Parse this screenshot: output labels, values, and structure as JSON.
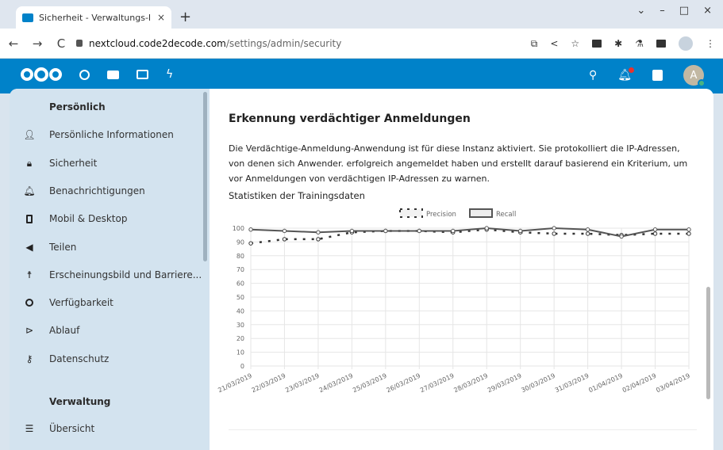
{
  "browser": {
    "tab_title": "Sicherheit - Verwaltungs-Ein",
    "tab_close": "×",
    "new_tab": "+",
    "url_host": "nextcloud.code2decode.com",
    "url_path": "/settings/admin/security",
    "win_min": "–",
    "win_max": "□",
    "win_close": "×",
    "chevron": "⌄",
    "back": "←",
    "forward": "→",
    "reload": "C"
  },
  "sidebar": {
    "personal_caption": "Persönlich",
    "personal_items": [
      {
        "label": "Persönliche Informationen",
        "icon": "person-icon"
      },
      {
        "label": "Sicherheit",
        "icon": "lock-icon"
      },
      {
        "label": "Benachrichtigungen",
        "icon": "bell-icon"
      },
      {
        "label": "Mobil & Desktop",
        "icon": "phone-icon"
      },
      {
        "label": "Teilen",
        "icon": "share-icon"
      },
      {
        "label": "Erscheinungsbild und Barriere...",
        "icon": "accessibility-icon"
      },
      {
        "label": "Verfügbarkeit",
        "icon": "clock-icon"
      },
      {
        "label": "Ablauf",
        "icon": "flow-icon"
      },
      {
        "label": "Datenschutz",
        "icon": "key-icon"
      }
    ],
    "admin_caption": "Verwaltung",
    "admin_items": [
      {
        "label": "Übersicht",
        "icon": "list-icon"
      }
    ]
  },
  "content": {
    "title": "Erkennung verdächtiger Anmeldungen",
    "description": "Die Verdächtige-Anmeldung-Anwendung ist für diese Instanz aktiviert. Sie protokolliert die IP-Adressen, von denen sich Anwender. erfolgreich angemeldet haben und erstellt darauf basierend ein Kriterium, um vor Anmeldungen von verdächtigen IP-Adressen zu warnen.",
    "stats_title": "Statistiken der Trainingsdaten"
  },
  "chart_data": {
    "type": "line",
    "categories": [
      "21/03/2019",
      "22/03/2019",
      "23/03/2019",
      "24/03/2019",
      "25/03/2019",
      "26/03/2019",
      "27/03/2019",
      "28/03/2019",
      "29/03/2019",
      "30/03/2019",
      "31/03/2019",
      "01/04/2019",
      "02/04/2019",
      "03/04/2019"
    ],
    "series": [
      {
        "name": "Precision",
        "style": "dashed",
        "color": "#333333",
        "values": [
          89,
          92,
          92,
          97,
          98,
          98,
          97,
          99,
          97,
          96,
          96,
          95,
          96,
          96
        ]
      },
      {
        "name": "Recall",
        "style": "solid",
        "color": "#555555",
        "values": [
          99,
          98,
          97,
          98,
          98,
          98,
          98,
          100,
          98,
          100,
          99,
          94,
          99,
          99
        ]
      }
    ],
    "yticks": [
      "0",
      "10",
      "20",
      "30",
      "40",
      "50",
      "60",
      "70",
      "80",
      "90",
      "100"
    ],
    "ylim": [
      0,
      100
    ],
    "grid": true,
    "legend_position": "top-center"
  },
  "colors": {
    "brand": "#0082c9",
    "sidebar_bg": "#d3e3ef"
  }
}
